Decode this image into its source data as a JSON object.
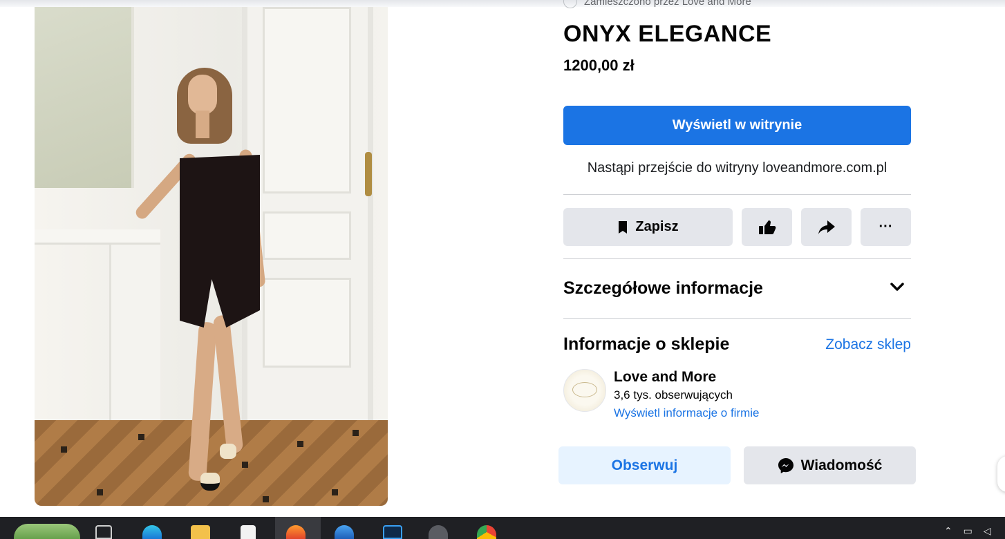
{
  "product": {
    "breadcrumb": "Zamieszczono przez Love and More",
    "title": "ONYX ELEGANCE",
    "price": "1200,00 zł",
    "image_alt": "Model wearing a black strapless dress with a high slit"
  },
  "actions": {
    "view_on_site_label": "Wyświetl w witrynie",
    "redirect_note": "Nastąpi przejście do witryny loveandmore.com.pl",
    "save_label": "Zapisz",
    "like_icon": "thumbs-up-icon",
    "share_icon": "share-arrow-icon",
    "more_label": "···"
  },
  "details_section": {
    "title": "Szczegółowe informacje"
  },
  "shop": {
    "section_title": "Informacje o sklepie",
    "see_shop_label": "Zobacz sklep",
    "name": "Love and More",
    "followers": "3,6 tys. obserwujących",
    "business_info_link": "Wyświetl informacje o firmie",
    "follow_label": "Obserwuj",
    "message_label": "Wiadomość"
  },
  "colors": {
    "primary_blue": "#1b74e4",
    "secondary_button": "#e4e6eb",
    "follow_button_bg": "#e7f3ff",
    "taskbar": "#1f2024"
  },
  "taskbar": {
    "apps": [
      "task-view",
      "edge",
      "file-explorer",
      "notepad",
      "firefox",
      "thunderbird",
      "photoshop",
      "network-tool",
      "chrome"
    ]
  }
}
